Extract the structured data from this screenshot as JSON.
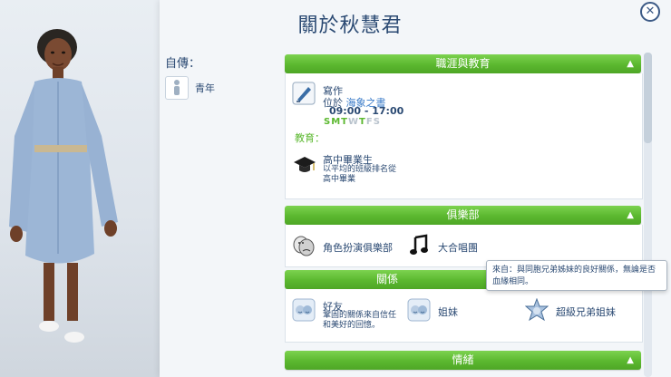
{
  "header": {
    "title": "關於秋慧君",
    "close_icon": "close-icon"
  },
  "bio": {
    "label": "自傳：",
    "age": "青年"
  },
  "career_section": {
    "title": "職涯與教育",
    "job_title": "寫作",
    "location_prefix": "位於",
    "location": "海象之書",
    "hours": "09:00 - 17:00",
    "days": [
      {
        "letter": "S",
        "active": true
      },
      {
        "letter": "M",
        "active": true
      },
      {
        "letter": "T",
        "active": true
      },
      {
        "letter": "W",
        "active": false
      },
      {
        "letter": "T",
        "active": true
      },
      {
        "letter": "F",
        "active": false
      },
      {
        "letter": "S",
        "active": false
      }
    ],
    "education_label": "教育：",
    "education_title": "高中畢業生",
    "education_desc_1": "以平均的班級排名從",
    "education_desc_2": "高中畢業"
  },
  "clubs_section": {
    "title": "俱樂部",
    "items": [
      {
        "label": "角色扮演俱樂部",
        "icon": "theater-masks-icon"
      },
      {
        "label": "大合唱團",
        "icon": "music-note-icon"
      }
    ]
  },
  "relations_section": {
    "title": "關係",
    "friend_label": "好友",
    "friend_desc_1": "鞏固的關係來自信任",
    "friend_desc_2": "和美好的回憶。",
    "sister_label": "姐妹",
    "super_label": "超級兄弟姐妹"
  },
  "tooltip": {
    "text": "來自：與同胞兄弟姊妹的良好關係，無論是否血緣相同。"
  },
  "mood_section": {
    "title": "情緒"
  },
  "colors": {
    "accent_green": "#5bb82f",
    "title_blue": "#2b4a73",
    "day_active": "#5bb82f",
    "day_inactive": "#b9c3cd"
  }
}
